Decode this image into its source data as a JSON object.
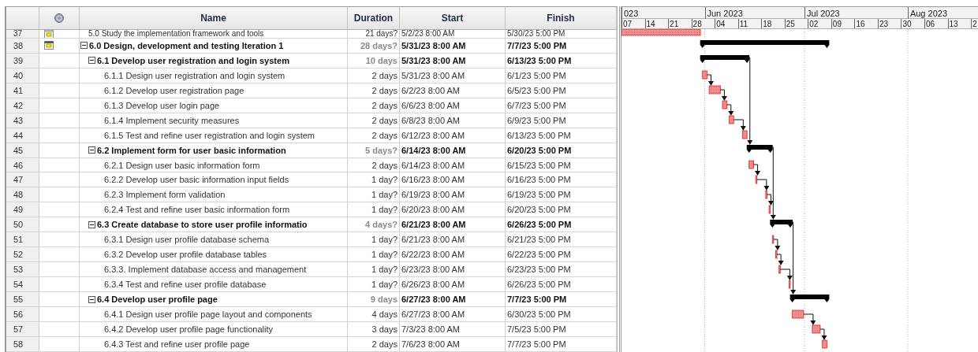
{
  "table": {
    "columns": [
      {
        "kind": "number"
      },
      {
        "kind": "indicator"
      },
      {
        "kind": "name",
        "label": "Name"
      },
      {
        "kind": "duration",
        "label": "Duration"
      },
      {
        "kind": "start",
        "label": "Start"
      },
      {
        "kind": "finish",
        "label": "Finish"
      }
    ],
    "tasks": [
      {
        "id": "37",
        "kind": "task",
        "partial": true,
        "indicator": true,
        "name": "5.0 Study the implementation framework and tools",
        "duration": "21 days?",
        "start": "5/2/23 8:00 AM",
        "finish": "5/30/23 5:00 PM"
      },
      {
        "id": "38",
        "kind": "summary",
        "expanded": true,
        "indicator": true,
        "name": "6.0 Design, development and testing Iteration 1",
        "duration": "28 days?",
        "start": "5/31/23 8:00 AM",
        "finish": "7/7/23 5:00 PM",
        "children": [
          {
            "id": "39",
            "kind": "summary",
            "expanded": true,
            "name": "6.1 Develop user registration and login system",
            "duration": "10 days",
            "start": "5/31/23 8:00 AM",
            "finish": "6/13/23 5:00 PM",
            "children": [
              {
                "id": "40",
                "kind": "task",
                "name": "6.1.1 Design user registration and login system",
                "duration": "2 days",
                "start": "5/31/23 8:00 AM",
                "finish": "6/1/23 5:00 PM"
              },
              {
                "id": "41",
                "kind": "task",
                "name": "6.1.2 Develop user registration page",
                "duration": "2 days",
                "start": "6/2/23 8:00 AM",
                "finish": "6/5/23 5:00 PM"
              },
              {
                "id": "42",
                "kind": "task",
                "name": "6.1.3 Develop user login page",
                "duration": "2 days",
                "start": "6/6/23 8:00 AM",
                "finish": "6/7/23 5:00 PM"
              },
              {
                "id": "43",
                "kind": "task",
                "name": "6.1.4 Implement security measures",
                "duration": "2 days",
                "start": "6/8/23 8:00 AM",
                "finish": "6/9/23 5:00 PM"
              },
              {
                "id": "44",
                "kind": "task",
                "name": "6.1.5 Test and refine user registration and login system",
                "duration": "2 days",
                "start": "6/12/23 8:00 AM",
                "finish": "6/13/23 5:00 PM"
              }
            ]
          },
          {
            "id": "45",
            "kind": "summary",
            "expanded": true,
            "name": "6.2 Implement form for user basic information",
            "duration": "5 days?",
            "start": "6/14/23 8:00 AM",
            "finish": "6/20/23 5:00 PM",
            "children": [
              {
                "id": "46",
                "kind": "task",
                "name": "6.2.1 Design user basic information form",
                "duration": "2 days",
                "start": "6/14/23 8:00 AM",
                "finish": "6/15/23 5:00 PM"
              },
              {
                "id": "47",
                "kind": "task",
                "name": "6.2.2 Develop user basic information input fields",
                "duration": "1 day?",
                "start": "6/16/23 8:00 AM",
                "finish": "6/16/23 5:00 PM"
              },
              {
                "id": "48",
                "kind": "task",
                "name": "6.2.3 Implement form validation",
                "duration": "1 day?",
                "start": "6/19/23 8:00 AM",
                "finish": "6/19/23 5:00 PM"
              },
              {
                "id": "49",
                "kind": "task",
                "name": "6.2.4 Test and refine user basic information form",
                "duration": "1 day?",
                "start": "6/20/23 8:00 AM",
                "finish": "6/20/23 5:00 PM"
              }
            ]
          },
          {
            "id": "50",
            "kind": "summary",
            "expanded": true,
            "name": "6.3 Create database to store user profile informatio",
            "duration": "4 days?",
            "start": "6/21/23 8:00 AM",
            "finish": "6/26/23 5:00 PM",
            "children": [
              {
                "id": "51",
                "kind": "task",
                "name": "6.3.1 Design user profile database schema",
                "duration": "1 day?",
                "start": "6/21/23 8:00 AM",
                "finish": "6/21/23 5:00 PM"
              },
              {
                "id": "52",
                "kind": "task",
                "name": "6.3.2 Develop user profile database tables",
                "duration": "1 day?",
                "start": "6/22/23 8:00 AM",
                "finish": "6/22/23 5:00 PM"
              },
              {
                "id": "53",
                "kind": "task",
                "name": "6.3.3. Implement database access and management",
                "duration": "1 day?",
                "start": "6/23/23 8:00 AM",
                "finish": "6/23/23 5:00 PM"
              },
              {
                "id": "54",
                "kind": "task",
                "name": "6.3.4 Test and refine user profile database",
                "duration": "1 day?",
                "start": "6/26/23 8:00 AM",
                "finish": "6/26/23 5:00 PM"
              }
            ]
          },
          {
            "id": "55",
            "kind": "summary",
            "expanded": true,
            "name": "6.4 Develop user profile page",
            "duration": "9 days",
            "start": "6/27/23 8:00 AM",
            "finish": "7/7/23 5:00 PM",
            "children": [
              {
                "id": "56",
                "kind": "task",
                "name": "6.4.1 Design user profile page layout and components",
                "duration": "4 days",
                "start": "6/27/23 8:00 AM",
                "finish": "6/30/23 5:00 PM"
              },
              {
                "id": "57",
                "kind": "task",
                "name": "6.4.2 Develop user profile page functionality",
                "duration": "3 days",
                "start": "7/3/23 8:00 AM",
                "finish": "7/5/23 5:00 PM"
              },
              {
                "id": "58",
                "kind": "task",
                "name": "6.4.3 Test and refine user profile page",
                "duration": "2 days",
                "start": "7/6/23 8:00 AM",
                "finish": "7/7/23 5:00 PM"
              }
            ]
          }
        ]
      }
    ]
  },
  "gantt": {
    "months": [
      "023",
      "Jun 2023",
      "Jul 2023",
      "Aug 2023"
    ],
    "days": [
      "07",
      "14",
      "21",
      "28",
      "04",
      "11",
      "18",
      "25",
      "02",
      "09",
      "16",
      "23",
      "30",
      "06",
      "13",
      "2"
    ]
  }
}
